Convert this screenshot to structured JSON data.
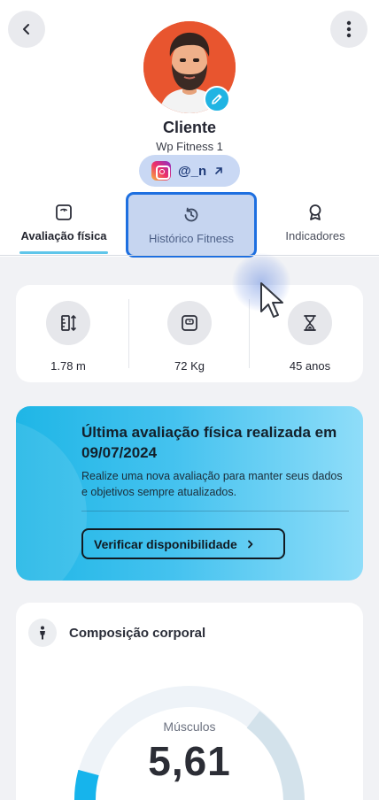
{
  "header": {
    "back_icon": "chevron-left-icon",
    "more_icon": "more-vertical-icon",
    "name": "Cliente",
    "subtitle": "Wp Fitness 1",
    "instagram_handle": "@_n",
    "edit_icon": "pencil-icon"
  },
  "tabs": [
    {
      "label": "Avaliação física",
      "icon": "scale-icon",
      "active": true
    },
    {
      "label": "Histórico Fitness",
      "icon": "history-icon",
      "active": false
    },
    {
      "label": "Indicadores",
      "icon": "award-icon",
      "active": false
    }
  ],
  "stats": [
    {
      "value": "1.78 m",
      "icon": "height-icon"
    },
    {
      "value": "72 Kg",
      "icon": "weight-scale-icon"
    },
    {
      "value": "45 anos",
      "icon": "hourglass-icon"
    }
  ],
  "promo": {
    "title": "Última avaliação física realizada em  09/07/2024",
    "text": "Realize uma nova avaliação para manter seus dados e objetivos sempre atualizados.",
    "button_label": "Verificar disponibilidade"
  },
  "composition": {
    "title": "Composição corporal",
    "gauge_label": "Músculos",
    "gauge_value": "5,61"
  },
  "colors": {
    "accent": "#20b4e3",
    "highlight_border": "#1d6fe0",
    "highlight_fill": "#c6d5f0",
    "avatar_bg": "#e8552f"
  }
}
